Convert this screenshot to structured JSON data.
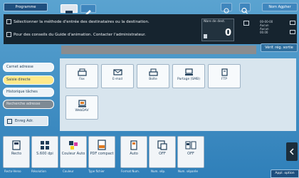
{
  "topbar": {
    "program_button": "Programme",
    "user_button": "Nom Agpher"
  },
  "message": {
    "line1": "Sélectionner la méthode d'entrée des destinataires ou la destination.",
    "line2": "Pour des conseils du Guide d'animation. Contacter l'administrateur.",
    "nb_label": "Nbre de dest.",
    "nb_value": "0",
    "status": "00-00-00\nAucun\nAucun\n00.00"
  },
  "side": {
    "items": [
      {
        "label": "Carnet adresse"
      },
      {
        "label": "Saisie directe"
      },
      {
        "label": "Historique tâches"
      },
      {
        "label": "Recherche adresse"
      }
    ],
    "edit_address": "Enreg Adr."
  },
  "verif_button": "Vérif. rég. sortie",
  "tiles": [
    {
      "label": "Fax",
      "icon": "fax-icon"
    },
    {
      "label": "E-mail",
      "icon": "email-icon"
    },
    {
      "label": "Boîte",
      "icon": "box-icon"
    },
    {
      "label": "Partage (SMB)",
      "icon": "pc-smb-icon"
    },
    {
      "label": "FTP",
      "icon": "ftp-icon"
    },
    {
      "label": "WebDAV",
      "icon": "webdav-icon"
    }
  ],
  "fkeys": [
    {
      "value": "Recto",
      "caption": "Recto-Verso",
      "icon": "recto-icon"
    },
    {
      "value": "S.600 dpi",
      "caption": "Résolution",
      "icon": "resolution-icon"
    },
    {
      "value": "Couleur Auto",
      "caption": "Couleur",
      "icon": "color-icon"
    },
    {
      "value": "PDF compact",
      "caption": "Type fichier",
      "icon": "pdf-icon"
    },
    {
      "value": "Auto",
      "caption": "Format Num.",
      "icon": "scan-size-icon"
    },
    {
      "value": "OFF",
      "caption": "Num. sép.",
      "icon": "separate-icon"
    },
    {
      "value": "OFF",
      "caption": "Num. séparée",
      "icon": "separate-pages-icon"
    }
  ],
  "apply_button": "Appl. option"
}
